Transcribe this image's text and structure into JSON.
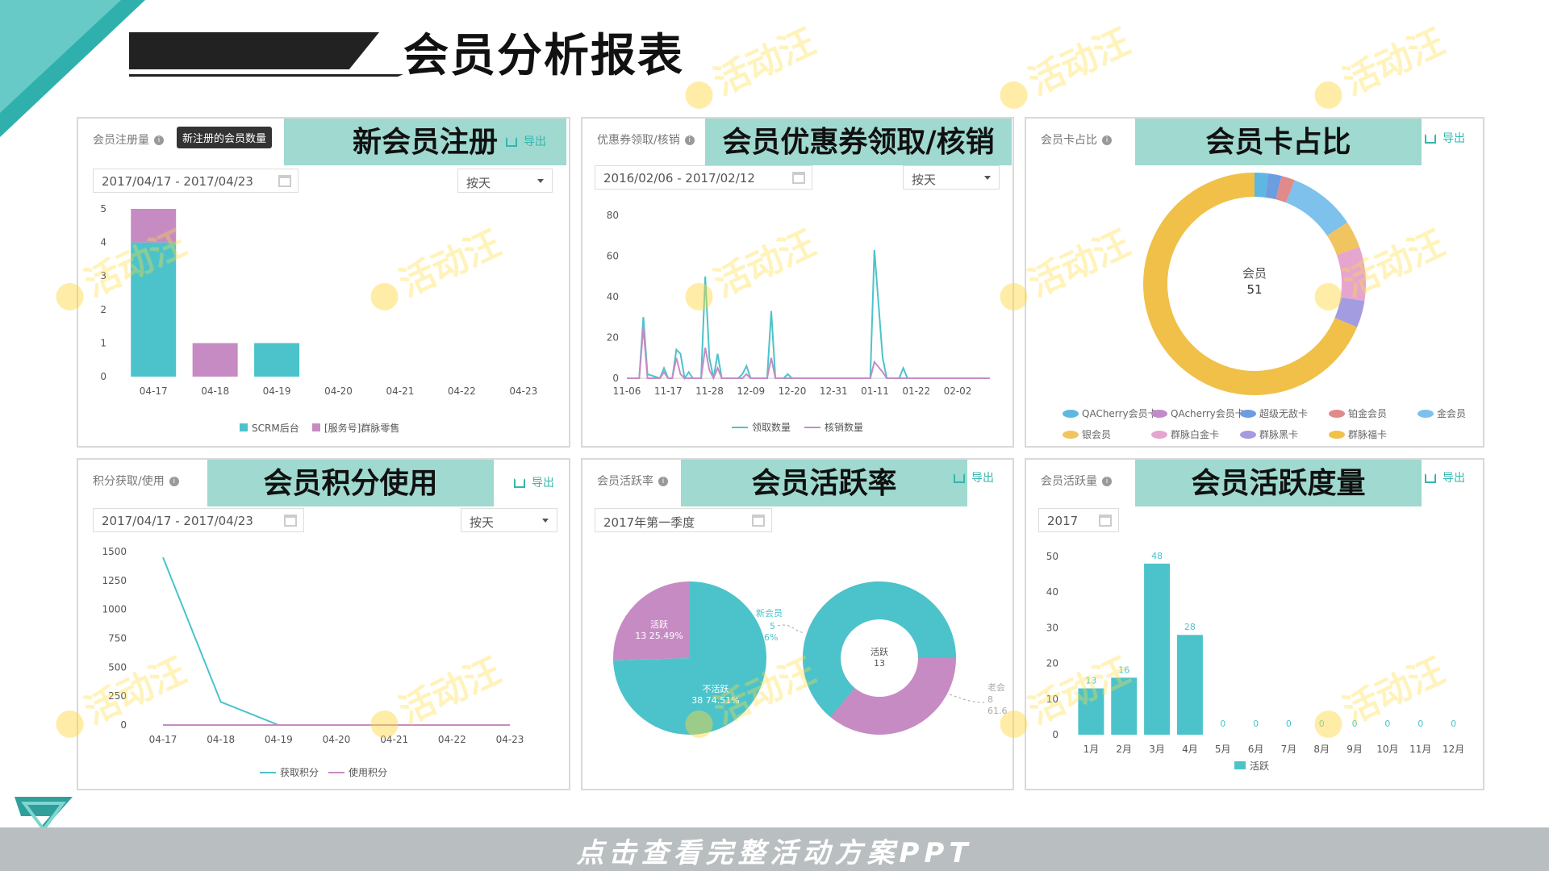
{
  "title": "会员分析报表",
  "footer": "点击查看完整活动方案PPT",
  "watermark": "活动汪",
  "colors": {
    "teal": "#4cc3cb",
    "purple": "#c78bc4",
    "accent": "#35b5ad",
    "banner": "#9fd9cf",
    "gold": "#f0c048"
  },
  "panels": {
    "reg": {
      "label": "会员注册量",
      "tooltip": "新注册的会员数量",
      "banner": "新会员注册",
      "export": "导出",
      "date": "2017/04/17 - 2017/04/23",
      "mode": "按天",
      "legend": [
        "SCRM后台",
        "[服务号]群脉零售"
      ]
    },
    "coupon": {
      "label": "优惠券领取/核销",
      "banner": "会员优惠券领取/核销",
      "export": "导出",
      "date": "2016/02/06 - 2017/02/12",
      "mode": "按天",
      "legend": [
        "领取数量",
        "核销数量"
      ]
    },
    "card": {
      "label": "会员卡占比",
      "banner": "会员卡占比",
      "export": "导出",
      "center_label": "会员",
      "center_value": "51",
      "legend": [
        "QACherry会员卡",
        "QAcherry会员卡",
        "超级无敌卡",
        "铂金会员",
        "金会员",
        "银会员",
        "群脉白金卡",
        "群脉黑卡",
        "群脉福卡"
      ]
    },
    "points": {
      "label": "积分获取/使用",
      "banner": "会员积分使用",
      "export": "导出",
      "date": "2017/04/17 - 2017/04/23",
      "mode": "按天",
      "legend": [
        "获取积分",
        "使用积分"
      ]
    },
    "active": {
      "label": "会员活跃率",
      "banner": "会员活跃率",
      "export": "导出",
      "date": "2017年第一季度",
      "pie1_active": "活跃",
      "pie1_active_val": "13 25.49%",
      "pie1_inactive": "不活跃",
      "pie1_inactive_val": "38 74.51%",
      "pie1_new": "新会员",
      "pie1_new_val": "5",
      "pie1_new_pct": "6%",
      "pie2_center": "活跃",
      "pie2_center_val": "13",
      "pie2_old": "老会",
      "pie2_old_val": "8",
      "pie2_old_pct": "61.6"
    },
    "degree": {
      "label": "会员活跃量",
      "banner": "会员活跃度量",
      "export": "导出",
      "date": "2017",
      "legend": [
        "活跃"
      ]
    }
  },
  "chart_data": [
    {
      "type": "bar",
      "title": "新会员注册",
      "categories": [
        "04-17",
        "04-18",
        "04-19",
        "04-20",
        "04-21",
        "04-22",
        "04-23"
      ],
      "series": [
        {
          "name": "SCRM后台",
          "values": [
            4,
            0,
            1,
            0,
            0,
            0,
            0
          ]
        },
        {
          "name": "[服务号]群脉零售",
          "values": [
            1,
            1,
            0,
            0,
            0,
            0,
            0
          ]
        }
      ],
      "ylim": [
        0,
        5
      ],
      "yticks": [
        0,
        1,
        2,
        3,
        4,
        5
      ],
      "stacked": true
    },
    {
      "type": "line",
      "title": "会员优惠券领取/核销",
      "xticks": [
        "11-06",
        "11-17",
        "11-28",
        "12-09",
        "12-20",
        "12-31",
        "01-11",
        "01-22",
        "02-02"
      ],
      "ylim": [
        0,
        80
      ],
      "yticks": [
        0,
        20,
        40,
        60,
        80
      ],
      "x": [
        0,
        3,
        4,
        5,
        8,
        9,
        10,
        11,
        12,
        13,
        14,
        15,
        16,
        18,
        19,
        20,
        21,
        22,
        23,
        24,
        25,
        27,
        28,
        29,
        30,
        31,
        32,
        34,
        35,
        36,
        37,
        38,
        39,
        40,
        41,
        42,
        44,
        45,
        46,
        47,
        48,
        49,
        50,
        51,
        52,
        53,
        54,
        56,
        58,
        59,
        60,
        62,
        63,
        66,
        67,
        68,
        69,
        70,
        72,
        74,
        76,
        77,
        80,
        82,
        84,
        87,
        88
      ],
      "series": [
        {
          "name": "领取数量",
          "values": [
            0,
            0,
            30,
            2,
            0,
            5,
            0,
            0,
            14,
            12,
            0,
            3,
            0,
            0,
            50,
            10,
            0,
            12,
            0,
            0,
            0,
            0,
            2,
            6,
            0,
            0,
            0,
            0,
            33,
            0,
            0,
            0,
            2,
            0,
            0,
            0,
            0,
            0,
            0,
            0,
            0,
            0,
            0,
            0,
            0,
            0,
            0,
            0,
            0,
            0,
            63,
            10,
            0,
            0,
            5,
            0,
            0,
            0,
            0,
            0,
            0,
            0,
            0,
            0,
            0,
            0,
            0
          ]
        },
        {
          "name": "核销数量",
          "values": [
            0,
            0,
            25,
            0,
            0,
            3,
            0,
            0,
            10,
            2,
            0,
            0,
            0,
            0,
            15,
            4,
            0,
            5,
            0,
            0,
            0,
            0,
            0,
            2,
            0,
            0,
            0,
            0,
            10,
            0,
            0,
            0,
            0,
            0,
            0,
            0,
            0,
            0,
            0,
            0,
            0,
            0,
            0,
            0,
            0,
            0,
            0,
            0,
            0,
            0,
            8,
            3,
            0,
            0,
            0,
            0,
            0,
            0,
            0,
            0,
            0,
            0,
            0,
            0,
            0,
            0,
            0
          ]
        }
      ]
    },
    {
      "type": "pie",
      "title": "会员卡占比",
      "labels": [
        "QACherry会员卡",
        "QAcherry会员卡",
        "超级无敌卡",
        "铂金会员",
        "金会员",
        "银会员",
        "群脉白金卡",
        "群脉黑卡",
        "群脉福卡"
      ],
      "values": [
        1,
        0,
        1,
        1,
        5,
        2,
        4,
        2,
        35
      ],
      "colors": [
        "#5eb7e0",
        "#c18bc9",
        "#6c9de0",
        "#e08a8a",
        "#7dc1ec",
        "#f0c460",
        "#e6a5cf",
        "#a49ce0",
        "#f0c048"
      ]
    },
    {
      "type": "line",
      "title": "会员积分使用",
      "categories": [
        "04-17",
        "04-18",
        "04-19",
        "04-20",
        "04-21",
        "04-22",
        "04-23"
      ],
      "series": [
        {
          "name": "获取积分",
          "values": [
            1450,
            200,
            0,
            0,
            0,
            0,
            0
          ]
        },
        {
          "name": "使用积分",
          "values": [
            0,
            0,
            0,
            0,
            0,
            0,
            0
          ]
        }
      ],
      "ylim": [
        0,
        1500
      ],
      "yticks": [
        0,
        250,
        500,
        750,
        1000,
        1250,
        1500
      ]
    },
    {
      "type": "pie",
      "title": "会员活跃率",
      "labels": [
        "活跃",
        "不活跃"
      ],
      "values": [
        13,
        38
      ],
      "colors": [
        "#c78bc4",
        "#4cc3cb"
      ]
    },
    {
      "type": "bar",
      "title": "会员活跃度量",
      "categories": [
        "1月",
        "2月",
        "3月",
        "4月",
        "5月",
        "6月",
        "7月",
        "8月",
        "9月",
        "10月",
        "11月",
        "12月"
      ],
      "series": [
        {
          "name": "活跃",
          "values": [
            13,
            16,
            48,
            28,
            0,
            0,
            0,
            0,
            0,
            0,
            0,
            0
          ]
        }
      ],
      "ylim": [
        0,
        50
      ],
      "yticks": [
        0,
        10,
        20,
        30,
        40,
        50
      ]
    }
  ]
}
